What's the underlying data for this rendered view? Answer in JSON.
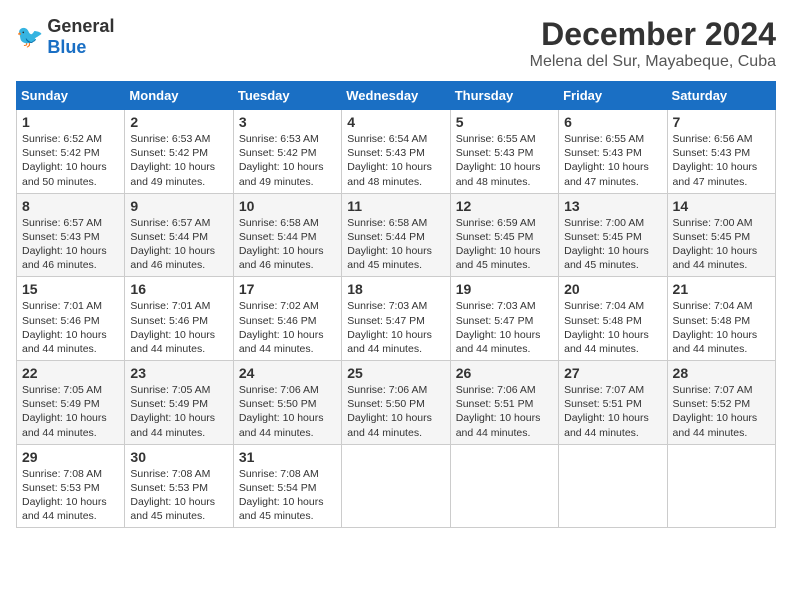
{
  "header": {
    "logo_general": "General",
    "logo_blue": "Blue",
    "main_title": "December 2024",
    "subtitle": "Melena del Sur, Mayabeque, Cuba"
  },
  "calendar": {
    "days_of_week": [
      "Sunday",
      "Monday",
      "Tuesday",
      "Wednesday",
      "Thursday",
      "Friday",
      "Saturday"
    ],
    "weeks": [
      [
        null,
        {
          "day": 2,
          "sunrise": "6:53 AM",
          "sunset": "5:42 PM",
          "daylight": "10 hours and 49 minutes."
        },
        {
          "day": 3,
          "sunrise": "6:53 AM",
          "sunset": "5:42 PM",
          "daylight": "10 hours and 49 minutes."
        },
        {
          "day": 4,
          "sunrise": "6:54 AM",
          "sunset": "5:43 PM",
          "daylight": "10 hours and 48 minutes."
        },
        {
          "day": 5,
          "sunrise": "6:55 AM",
          "sunset": "5:43 PM",
          "daylight": "10 hours and 48 minutes."
        },
        {
          "day": 6,
          "sunrise": "6:55 AM",
          "sunset": "5:43 PM",
          "daylight": "10 hours and 47 minutes."
        },
        {
          "day": 7,
          "sunrise": "6:56 AM",
          "sunset": "5:43 PM",
          "daylight": "10 hours and 47 minutes."
        }
      ],
      [
        {
          "day": 1,
          "sunrise": "6:52 AM",
          "sunset": "5:42 PM",
          "daylight": "10 hours and 50 minutes."
        },
        {
          "day": 9,
          "sunrise": "6:57 AM",
          "sunset": "5:44 PM",
          "daylight": "10 hours and 46 minutes."
        },
        {
          "day": 10,
          "sunrise": "6:58 AM",
          "sunset": "5:44 PM",
          "daylight": "10 hours and 46 minutes."
        },
        {
          "day": 11,
          "sunrise": "6:58 AM",
          "sunset": "5:44 PM",
          "daylight": "10 hours and 45 minutes."
        },
        {
          "day": 12,
          "sunrise": "6:59 AM",
          "sunset": "5:45 PM",
          "daylight": "10 hours and 45 minutes."
        },
        {
          "day": 13,
          "sunrise": "7:00 AM",
          "sunset": "5:45 PM",
          "daylight": "10 hours and 45 minutes."
        },
        {
          "day": 14,
          "sunrise": "7:00 AM",
          "sunset": "5:45 PM",
          "daylight": "10 hours and 44 minutes."
        }
      ],
      [
        {
          "day": 8,
          "sunrise": "6:57 AM",
          "sunset": "5:43 PM",
          "daylight": "10 hours and 46 minutes."
        },
        {
          "day": 16,
          "sunrise": "7:01 AM",
          "sunset": "5:46 PM",
          "daylight": "10 hours and 44 minutes."
        },
        {
          "day": 17,
          "sunrise": "7:02 AM",
          "sunset": "5:46 PM",
          "daylight": "10 hours and 44 minutes."
        },
        {
          "day": 18,
          "sunrise": "7:03 AM",
          "sunset": "5:47 PM",
          "daylight": "10 hours and 44 minutes."
        },
        {
          "day": 19,
          "sunrise": "7:03 AM",
          "sunset": "5:47 PM",
          "daylight": "10 hours and 44 minutes."
        },
        {
          "day": 20,
          "sunrise": "7:04 AM",
          "sunset": "5:48 PM",
          "daylight": "10 hours and 44 minutes."
        },
        {
          "day": 21,
          "sunrise": "7:04 AM",
          "sunset": "5:48 PM",
          "daylight": "10 hours and 44 minutes."
        }
      ],
      [
        {
          "day": 15,
          "sunrise": "7:01 AM",
          "sunset": "5:46 PM",
          "daylight": "10 hours and 44 minutes."
        },
        {
          "day": 23,
          "sunrise": "7:05 AM",
          "sunset": "5:49 PM",
          "daylight": "10 hours and 44 minutes."
        },
        {
          "day": 24,
          "sunrise": "7:06 AM",
          "sunset": "5:50 PM",
          "daylight": "10 hours and 44 minutes."
        },
        {
          "day": 25,
          "sunrise": "7:06 AM",
          "sunset": "5:50 PM",
          "daylight": "10 hours and 44 minutes."
        },
        {
          "day": 26,
          "sunrise": "7:06 AM",
          "sunset": "5:51 PM",
          "daylight": "10 hours and 44 minutes."
        },
        {
          "day": 27,
          "sunrise": "7:07 AM",
          "sunset": "5:51 PM",
          "daylight": "10 hours and 44 minutes."
        },
        {
          "day": 28,
          "sunrise": "7:07 AM",
          "sunset": "5:52 PM",
          "daylight": "10 hours and 44 minutes."
        }
      ],
      [
        {
          "day": 22,
          "sunrise": "7:05 AM",
          "sunset": "5:49 PM",
          "daylight": "10 hours and 44 minutes."
        },
        {
          "day": 30,
          "sunrise": "7:08 AM",
          "sunset": "5:53 PM",
          "daylight": "10 hours and 45 minutes."
        },
        {
          "day": 31,
          "sunrise": "7:08 AM",
          "sunset": "5:54 PM",
          "daylight": "10 hours and 45 minutes."
        },
        null,
        null,
        null,
        null
      ],
      [
        {
          "day": 29,
          "sunrise": "7:08 AM",
          "sunset": "5:53 PM",
          "daylight": "10 hours and 44 minutes."
        },
        null,
        null,
        null,
        null,
        null,
        null
      ]
    ]
  }
}
